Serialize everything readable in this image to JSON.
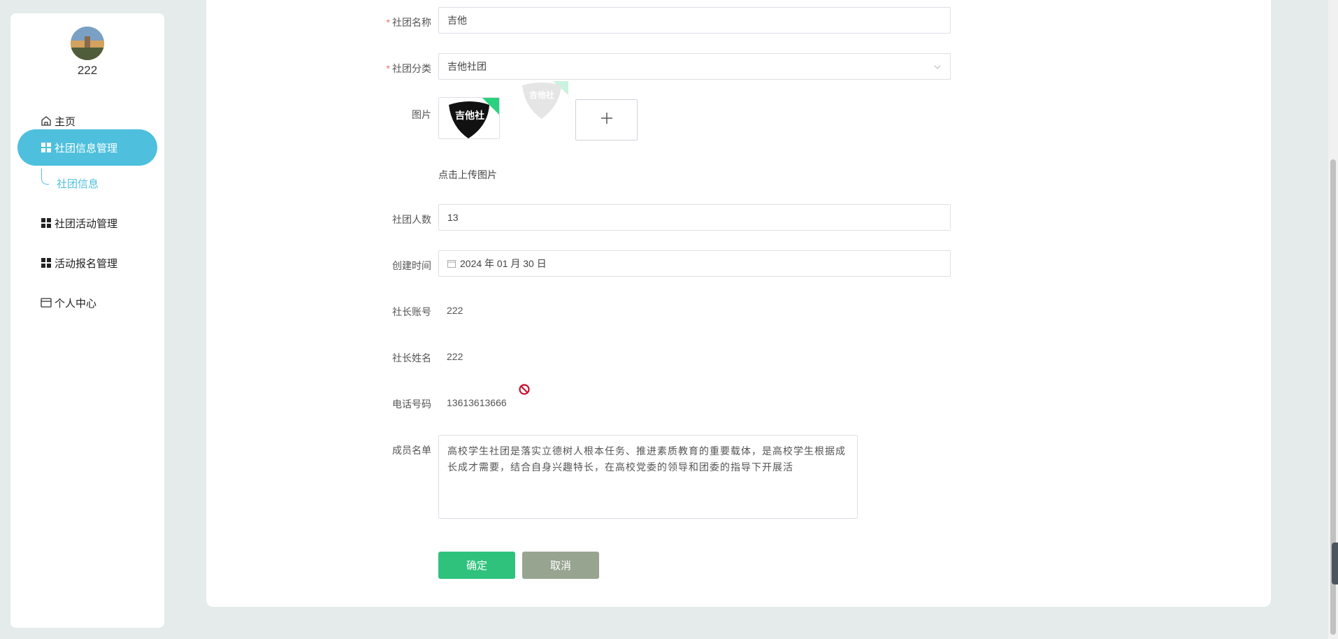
{
  "user": {
    "name": "222"
  },
  "sidebar": {
    "items": [
      {
        "label": "主页",
        "icon": "home-icon"
      },
      {
        "label": "社团信息管理",
        "icon": "grid-icon",
        "active": true
      },
      {
        "label": "社团活动管理",
        "icon": "grid-icon"
      },
      {
        "label": "活动报名管理",
        "icon": "grid-icon"
      },
      {
        "label": "个人中心",
        "icon": "card-icon"
      }
    ],
    "sub_item": "社团信息"
  },
  "form": {
    "name": {
      "label": "社团名称",
      "value": "吉他"
    },
    "category": {
      "label": "社团分类",
      "value": "吉他社团"
    },
    "image": {
      "label": "图片",
      "upload_hint": "点击上传图片",
      "thumb_text": "吉他社"
    },
    "members_count": {
      "label": "社团人数",
      "value": "13"
    },
    "created": {
      "label": "创建时间",
      "value": "2024 年 01 月 30 日"
    },
    "leader_account": {
      "label": "社长账号",
      "value": "222"
    },
    "leader_name": {
      "label": "社长姓名",
      "value": "222"
    },
    "phone": {
      "label": "电话号码",
      "value": "13613613666"
    },
    "member_list": {
      "label": "成员名单",
      "value": "高校学生社团是落实立德树人根本任务、推进素质教育的重要载体，是高校学生根据成长成才需要，结合自身兴趣特长，在高校党委的领导和团委的指导下开展活"
    }
  },
  "buttons": {
    "confirm": "确定",
    "cancel": "取消"
  },
  "colors": {
    "accent": "#4ec0de",
    "confirm": "#2fc27d",
    "cancel": "#97a590",
    "required": "#f56c6c"
  }
}
